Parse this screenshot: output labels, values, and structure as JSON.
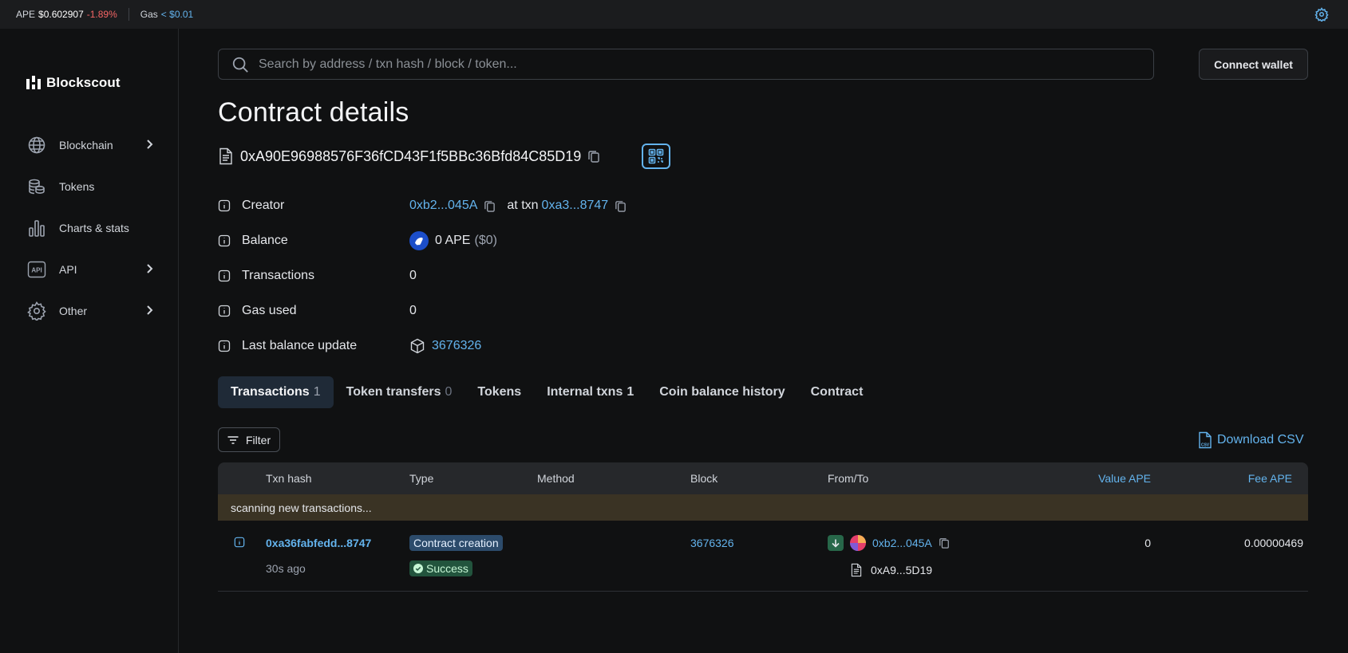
{
  "topbar": {
    "coin_label": "APE",
    "coin_price": "$0.602907",
    "coin_change": "-1.89%",
    "gas_label": "Gas",
    "gas_value": "< $0.01"
  },
  "sidebar": {
    "brand": "Blockscout",
    "items": [
      {
        "label": "Blockchain",
        "icon": "globe-icon",
        "has_children": true
      },
      {
        "label": "Tokens",
        "icon": "coins-icon",
        "has_children": false
      },
      {
        "label": "Charts & stats",
        "icon": "chart-icon",
        "has_children": false
      },
      {
        "label": "API",
        "icon": "api-icon",
        "has_children": true
      },
      {
        "label": "Other",
        "icon": "gear-icon",
        "has_children": true
      }
    ]
  },
  "search": {
    "placeholder": "Search by address / txn hash / block / token..."
  },
  "header": {
    "connect_label": "Connect wallet",
    "title": "Contract details",
    "address": "0xA90E96988576F36fCD43F1f5BBc36Bfd84C85D19"
  },
  "details": {
    "creator_label": "Creator",
    "creator_address": "0xb2...045A",
    "creator_at_txn": "at txn",
    "creator_txn": "0xa3...8747",
    "balance_label": "Balance",
    "balance_value": "0 APE",
    "balance_usd": "($0)",
    "transactions_label": "Transactions",
    "transactions_value": "0",
    "gas_label": "Gas used",
    "gas_value": "0",
    "last_update_label": "Last balance update",
    "last_update_block": "3676326"
  },
  "tabs": [
    {
      "label": "Transactions",
      "count": "1",
      "active": true
    },
    {
      "label": "Token transfers",
      "count": "0"
    },
    {
      "label": "Tokens",
      "count": ""
    },
    {
      "label": "Internal txns",
      "count": "1"
    },
    {
      "label": "Coin balance history",
      "count": ""
    },
    {
      "label": "Contract",
      "count": ""
    }
  ],
  "toolbar": {
    "filter_label": "Filter",
    "download_label": "Download CSV"
  },
  "table": {
    "headers": {
      "hash": "Txn hash",
      "type": "Type",
      "method": "Method",
      "block": "Block",
      "fromto": "From/To",
      "value": "Value APE",
      "fee": "Fee APE"
    },
    "scanning": "scanning new transactions...",
    "rows": [
      {
        "hash": "0xa36fabfedd...8747",
        "age": "30s ago",
        "type": "Contract creation",
        "status": "Success",
        "method": "",
        "block": "3676326",
        "from": "0xb2...045A",
        "to": "0xA9...5D19",
        "value": "0",
        "fee": "0.00000469"
      }
    ]
  }
}
